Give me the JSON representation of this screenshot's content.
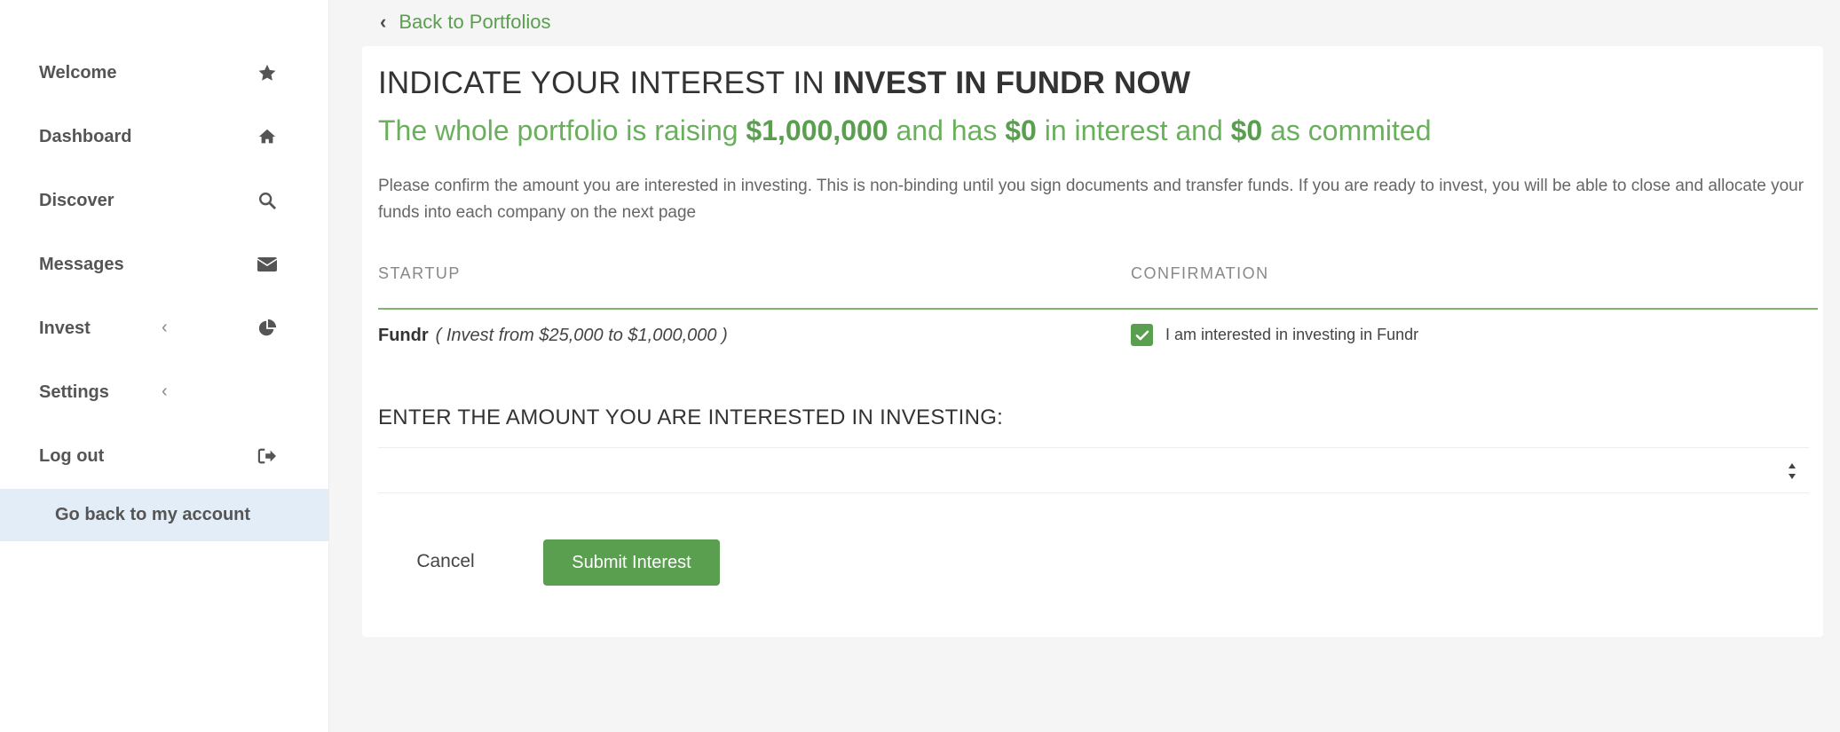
{
  "sidebar": {
    "items": [
      {
        "label": "Welcome",
        "icon": "star-icon"
      },
      {
        "label": "Dashboard",
        "icon": "home-icon"
      },
      {
        "label": "Discover",
        "icon": "search-icon"
      },
      {
        "label": "Messages",
        "icon": "envelope-icon"
      },
      {
        "label": "Invest",
        "icon": "pie-chart-icon",
        "expandable": true
      },
      {
        "label": "Settings",
        "expandable": true
      },
      {
        "label": "Log out",
        "icon": "sign-out-icon"
      }
    ],
    "go_back_label": "Go back to my account"
  },
  "back_link": {
    "label": "Back to Portfolios"
  },
  "card": {
    "title_prefix": "INDICATE YOUR INTEREST IN ",
    "title_bold": "INVEST IN FUNDR NOW",
    "subtitle": {
      "part1": "The whole portfolio is raising ",
      "raising": "$1,000,000",
      "part2": " and has ",
      "interest": "$0",
      "part3": " in interest and ",
      "committed": "$0",
      "part4": " as commited"
    },
    "description": "Please confirm the amount you are interested in investing. This is non-binding until you sign documents and transfer funds. If you are ready to invest, you will be able to close and allocate your funds into each company on the next page",
    "table": {
      "col_startup": "STARTUP",
      "col_confirmation": "CONFIRMATION",
      "row": {
        "startup_name": "Fundr",
        "range": "( Invest from $25,000 to $1,000,000 )",
        "confirmation_label": "I am interested in investing in Fundr",
        "checked": true
      }
    },
    "amount_label": "ENTER THE AMOUNT YOU ARE INTERESTED IN INVESTING:",
    "amount_value": "",
    "cancel_label": "Cancel",
    "submit_label": "Submit Interest"
  },
  "colors": {
    "accent": "#5a9e4f",
    "go_back_bg": "#e3edf8",
    "page_bg": "#f4f5f4"
  }
}
